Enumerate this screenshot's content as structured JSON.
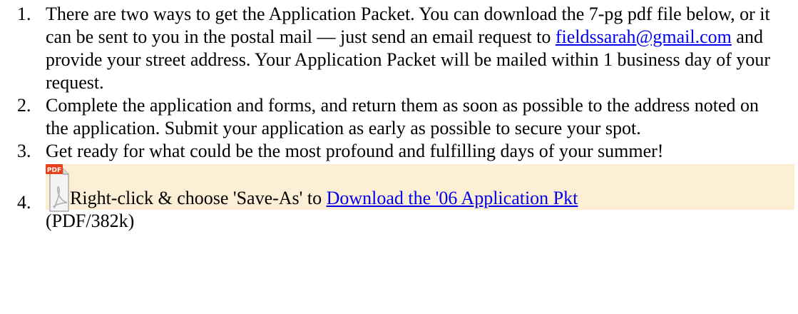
{
  "steps": [
    {
      "number": "1.",
      "text_before": "There are two ways to get the Application Packet. You can download the 7-pg pdf file below, or it can be sent to you in the postal mail — just send an email request to ",
      "email_link": "fieldssarah@gmail.com",
      "text_after": " and provide your street address. Your Application Packet will be mailed within 1 business day of your request."
    },
    {
      "number": "2.",
      "text": "Complete the application and forms, and return them as soon as possible to the address noted on the application. Submit your application as early as possible to secure your spot."
    },
    {
      "number": "3.",
      "text": "Get ready for what could be the most profound and fulfilling days of your summer!"
    },
    {
      "number": "4.",
      "icon": "pdf-file-icon",
      "icon_label": "PDF",
      "text_before": "Right-click & choose 'Save-As' to ",
      "download_link": "Download the '06 Application Pkt",
      "text_after": "(PDF/382k)"
    }
  ],
  "colors": {
    "link": "#0000ee",
    "highlight": "#fdeed6",
    "pdf_badge": "#e8401c"
  }
}
